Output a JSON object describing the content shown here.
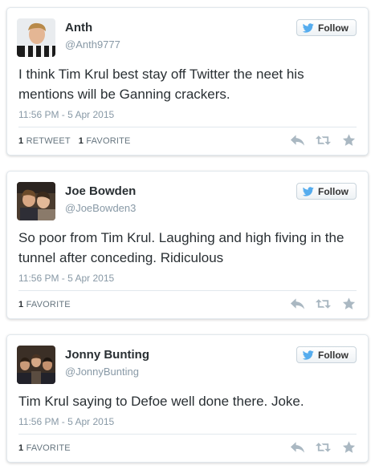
{
  "tweets": [
    {
      "name": "Anth",
      "handle": "@Anth9777",
      "follow_label": "Follow",
      "text": "I think Tim Krul best stay off Twitter the neet his mentions will be Ganning crackers.",
      "time": "11:56 PM - 5 Apr 2015",
      "stats": [
        {
          "count": "1",
          "label": "RETWEET"
        },
        {
          "count": "1",
          "label": "FAVORITE"
        }
      ]
    },
    {
      "name": "Joe Bowden",
      "handle": "@JoeBowden3",
      "follow_label": "Follow",
      "text": "So poor from Tim Krul. Laughing and high fiving in the tunnel after conceding. Ridiculous",
      "time": "11:56 PM - 5 Apr 2015",
      "stats": [
        {
          "count": "1",
          "label": "FAVORITE"
        }
      ]
    },
    {
      "name": "Jonny Bunting",
      "handle": "@JonnyBunting",
      "follow_label": "Follow",
      "text": "Tim Krul saying to Defoe well done there. Joke.",
      "time": "11:56 PM - 5 Apr 2015",
      "stats": [
        {
          "count": "1",
          "label": "FAVORITE"
        }
      ]
    }
  ],
  "colors": {
    "twitter_blue": "#55acee",
    "icon_gray": "#aab8c2",
    "meta_gray": "#8899a6"
  },
  "icons": {
    "follow": "twitter-bird-icon",
    "actions": [
      "reply-icon",
      "retweet-icon",
      "favorite-star-icon"
    ]
  }
}
